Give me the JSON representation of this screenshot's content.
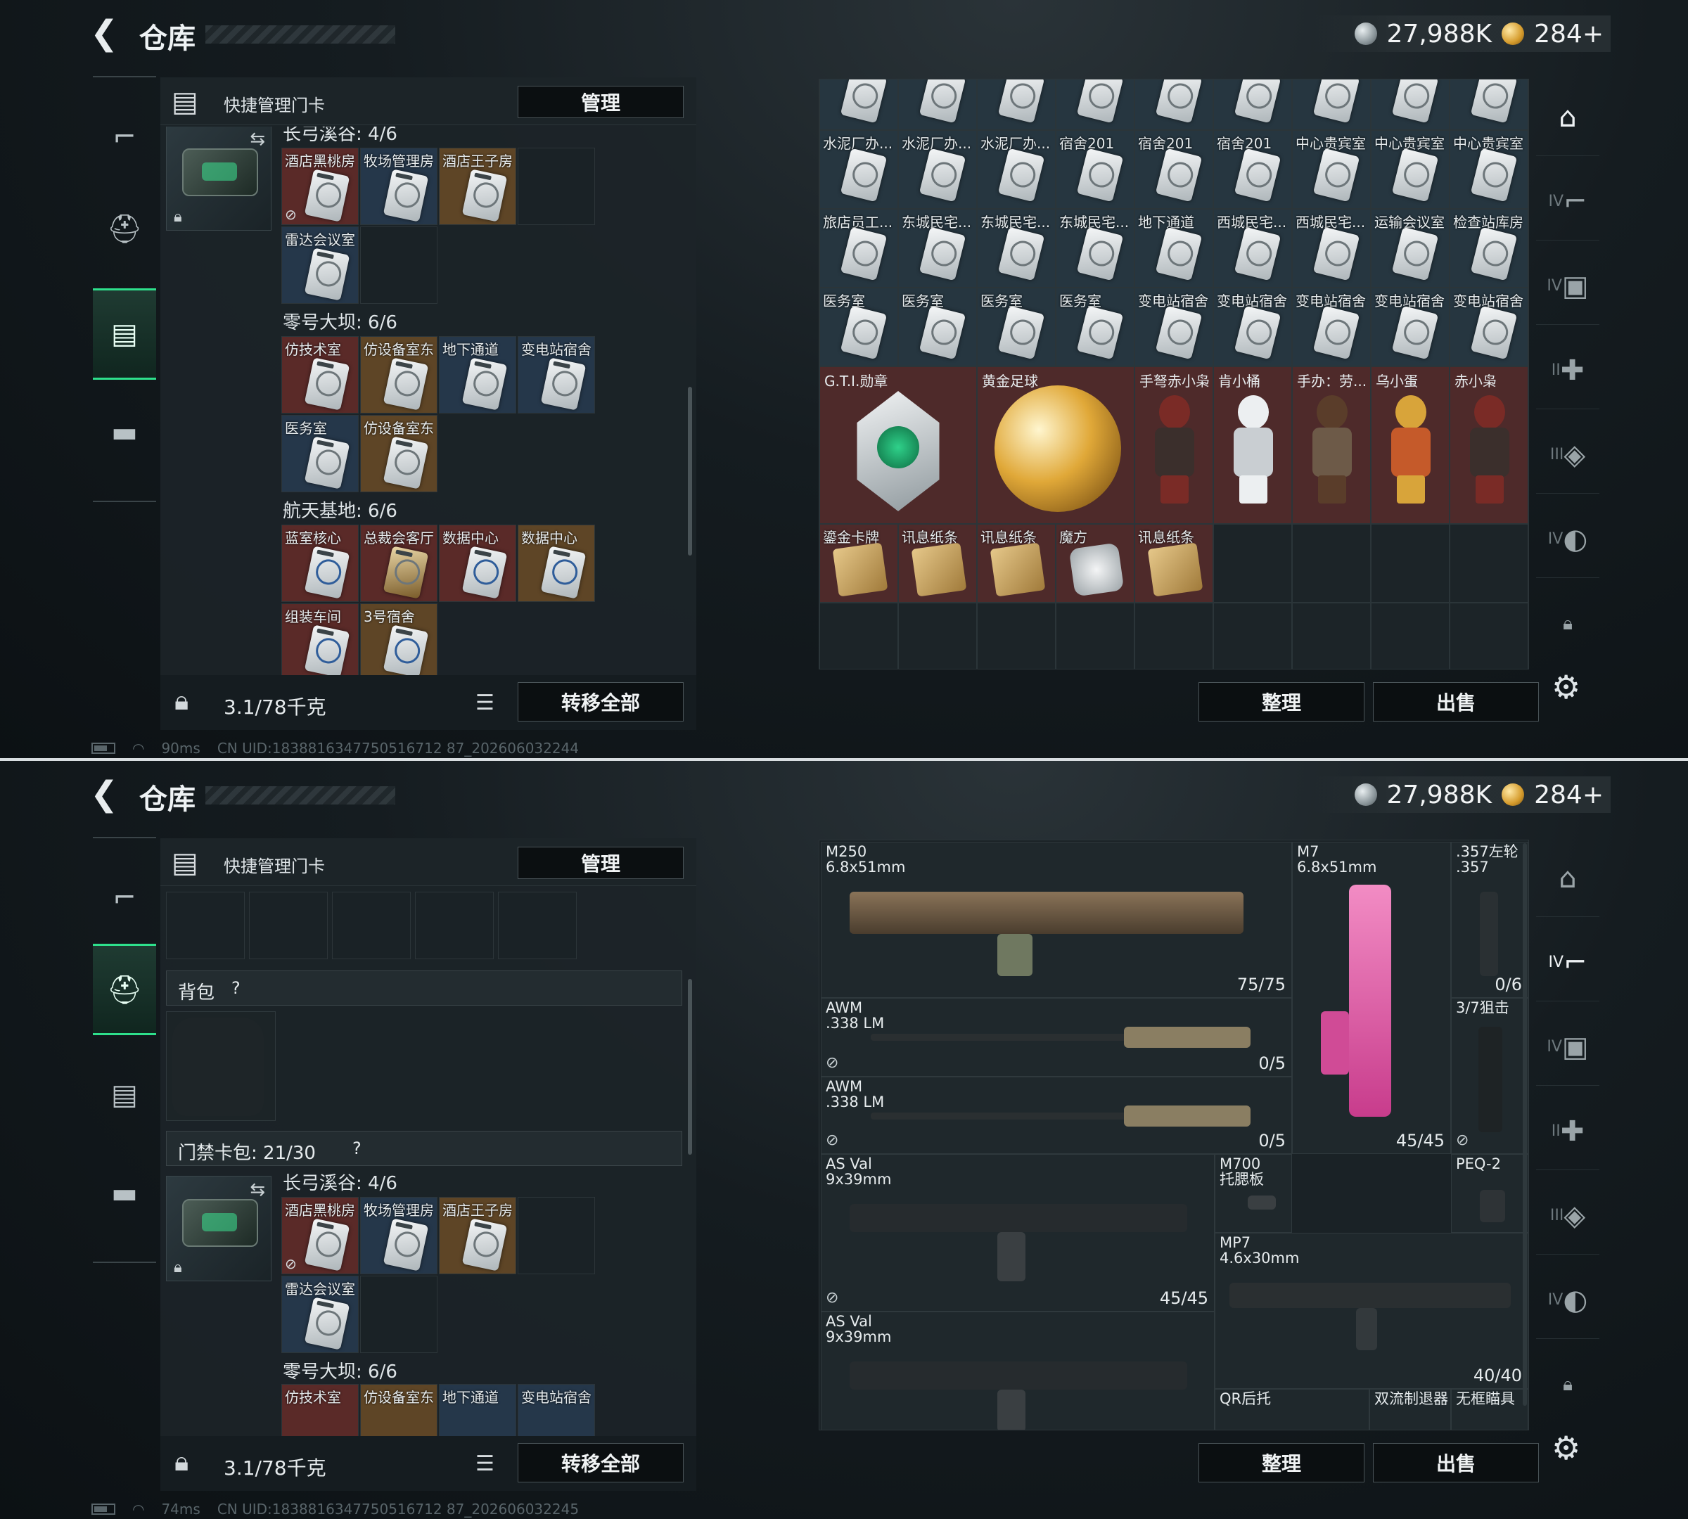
{
  "shots": [
    {
      "header": {
        "title": "仓库",
        "money": "27,988K",
        "gold": "284+"
      },
      "quick": {
        "title": "快捷管理门卡",
        "manage": "管理"
      },
      "groups": [
        {
          "title": "长弓溪谷: 4/6",
          "slots": [
            "酒店黑桃房",
            "牧场管理房",
            "酒店王子房",
            "雷达会议室"
          ]
        },
        {
          "title": "零号大坝: 6/6",
          "slots": [
            "仿技术室",
            "仿设备室东",
            "地下通道",
            "变电站宿舍",
            "医务室",
            "仿设备室东"
          ]
        },
        {
          "title": "航天基地: 6/6",
          "slots": [
            "蓝室核心",
            "总裁会客厅",
            "数据中心",
            "数据中心",
            "组装车间",
            "3号宿舍"
          ]
        }
      ],
      "footer": {
        "weight": "3.1/78千克",
        "transfer": "转移全部"
      },
      "status": {
        "ping": "90ms",
        "uid": "CN UID:1838816347750516712 87_202606032244"
      },
      "stash": {
        "row1": [
          "",
          "",
          "",
          "",
          "",
          "",
          "",
          "",
          ""
        ],
        "row2": [
          "水泥厂办...",
          "水泥厂办...",
          "水泥厂办...",
          "宿舍201",
          "宿舍201",
          "宿舍201",
          "中心贵宾室",
          "中心贵宾室",
          "中心贵宾室"
        ],
        "row3": [
          "旅店员工...",
          "东城民宅...",
          "东城民宅...",
          "东城民宅...",
          "地下通道",
          "西城民宅...",
          "西城民宅...",
          "运输会议室",
          "检查站库房"
        ],
        "row4": [
          "医务室",
          "医务室",
          "医务室",
          "医务室",
          "变电站宿舍",
          "变电站宿舍",
          "变电站宿舍",
          "变电站宿舍",
          "变电站宿舍"
        ],
        "collect": [
          "G.T.I.勋章",
          "黄金足球",
          "手弩赤小枭",
          "肯小桶",
          "手办：劳...",
          "乌小蛋",
          "赤小枭"
        ],
        "misc": [
          "鎏金卡牌",
          "讯息纸条",
          "讯息纸条",
          "魔方",
          "讯息纸条"
        ]
      },
      "actions": {
        "sort": "整理",
        "sell": "出售"
      },
      "rightnav": [
        "",
        "IV",
        "IV",
        "II",
        "III",
        "IV",
        ""
      ]
    },
    {
      "header": {
        "title": "仓库",
        "money": "27,988K",
        "gold": "284+"
      },
      "quick": {
        "title": "快捷管理门卡",
        "manage": "管理"
      },
      "backpack": {
        "title": "背包",
        "help": "?"
      },
      "cardpack": {
        "title": "门禁卡包: 21/30",
        "help": "?"
      },
      "groups": [
        {
          "title": "长弓溪谷: 4/6",
          "slots": [
            "酒店黑桃房",
            "牧场管理房",
            "酒店王子房",
            "雷达会议室"
          ]
        },
        {
          "title": "零号大坝: 6/6",
          "slots": [
            "仿技术室",
            "仿设备室东",
            "地下通道",
            "变电站宿舍"
          ]
        }
      ],
      "footer": {
        "weight": "3.1/78千克",
        "transfer": "转移全部"
      },
      "status": {
        "ping": "74ms",
        "uid": "CN UID:1838816347750516712 87_202606032245"
      },
      "weapons": [
        {
          "name": "M250\n6.8x51mm",
          "ammo": "75/75"
        },
        {
          "name": "M7\n6.8x51mm",
          "ammo": "45/45"
        },
        {
          "name": ".357左轮\n.357",
          "ammo": "0/6"
        },
        {
          "name": "AWM\n.338 LM",
          "ammo": "0/5"
        },
        {
          "name": "3/7狙击",
          "ammo": ""
        },
        {
          "name": "AWM\n.338 LM",
          "ammo": "0/5"
        },
        {
          "name": "AS Val\n9x39mm",
          "ammo": "45/45"
        },
        {
          "name": "M700\n托腮板",
          "ammo": ""
        },
        {
          "name": "PEQ-2",
          "ammo": ""
        },
        {
          "name": "MP7\n4.6x30mm",
          "ammo": "40/40"
        },
        {
          "name": "AS Val\n9x39mm",
          "ammo": ""
        },
        {
          "name": "QR后托",
          "ammo": ""
        },
        {
          "name": "双流制退器",
          "ammo": ""
        },
        {
          "name": "无框瞄具",
          "ammo": ""
        }
      ],
      "actions": {
        "sort": "整理",
        "sell": "出售"
      },
      "rightnav": [
        "",
        "IV",
        "IV",
        "II",
        "III",
        "IV",
        ""
      ]
    }
  ]
}
